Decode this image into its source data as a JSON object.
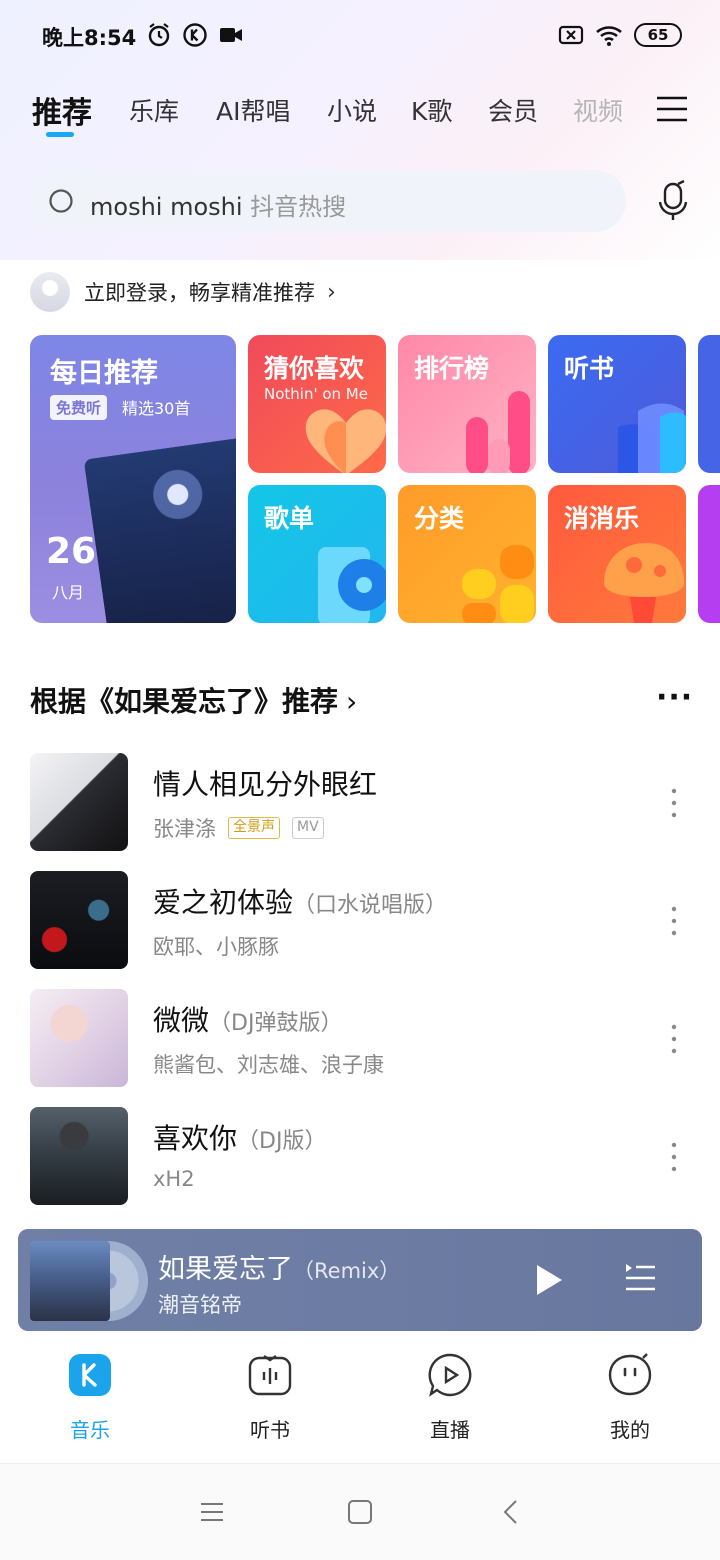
{
  "status_bar": {
    "time": "晚上8:54",
    "battery": "65"
  },
  "tabs": [
    {
      "label": "推荐",
      "active": true
    },
    {
      "label": "乐库"
    },
    {
      "label": "AI帮唱"
    },
    {
      "label": "小说"
    },
    {
      "label": "K歌"
    },
    {
      "label": "会员"
    },
    {
      "label": "视频"
    }
  ],
  "search": {
    "query": "moshi moshi",
    "hot_hint": "抖音热搜"
  },
  "login": {
    "text": "立即登录，畅享精准推荐"
  },
  "tiles": {
    "daily": {
      "title": "每日推荐",
      "badge": "免费听",
      "count": "精选30首",
      "day": "26",
      "month": "八月"
    },
    "guess": {
      "title": "猜你喜欢",
      "subtitle": "Nothin' on Me"
    },
    "rank": {
      "title": "排行榜"
    },
    "book": {
      "title": "听书"
    },
    "list": {
      "title": "歌单"
    },
    "category": {
      "title": "分类"
    },
    "game": {
      "title": "消消乐"
    }
  },
  "section": {
    "title": "根据《如果爱忘了》推荐",
    "more": "···"
  },
  "songs": [
    {
      "title": "情人相见分外眼红",
      "version": "",
      "artist": "张津涤",
      "badge_gold": "全景声",
      "badge_mv": "MV"
    },
    {
      "title": "爱之初体验",
      "version": "（口水说唱版）",
      "artist": "欧耶、小豚豚"
    },
    {
      "title": "微微",
      "version": "（DJ弹鼓版）",
      "artist": "熊酱包、刘志雄、浪子康"
    },
    {
      "title": "喜欢你",
      "version": "（DJ版）",
      "artist": "xH2"
    }
  ],
  "player": {
    "title": "如果爱忘了",
    "version": "（Remix）",
    "artist": "潮音铭帝"
  },
  "bottom_nav": [
    {
      "label": "音乐",
      "active": true,
      "icon": "music-k-icon"
    },
    {
      "label": "听书",
      "icon": "audiobook-icon"
    },
    {
      "label": "直播",
      "icon": "live-icon"
    },
    {
      "label": "我的",
      "icon": "profile-icon"
    }
  ],
  "colors": {
    "accent": "#1ba3ec",
    "player_bg": "#6d7ca3"
  }
}
